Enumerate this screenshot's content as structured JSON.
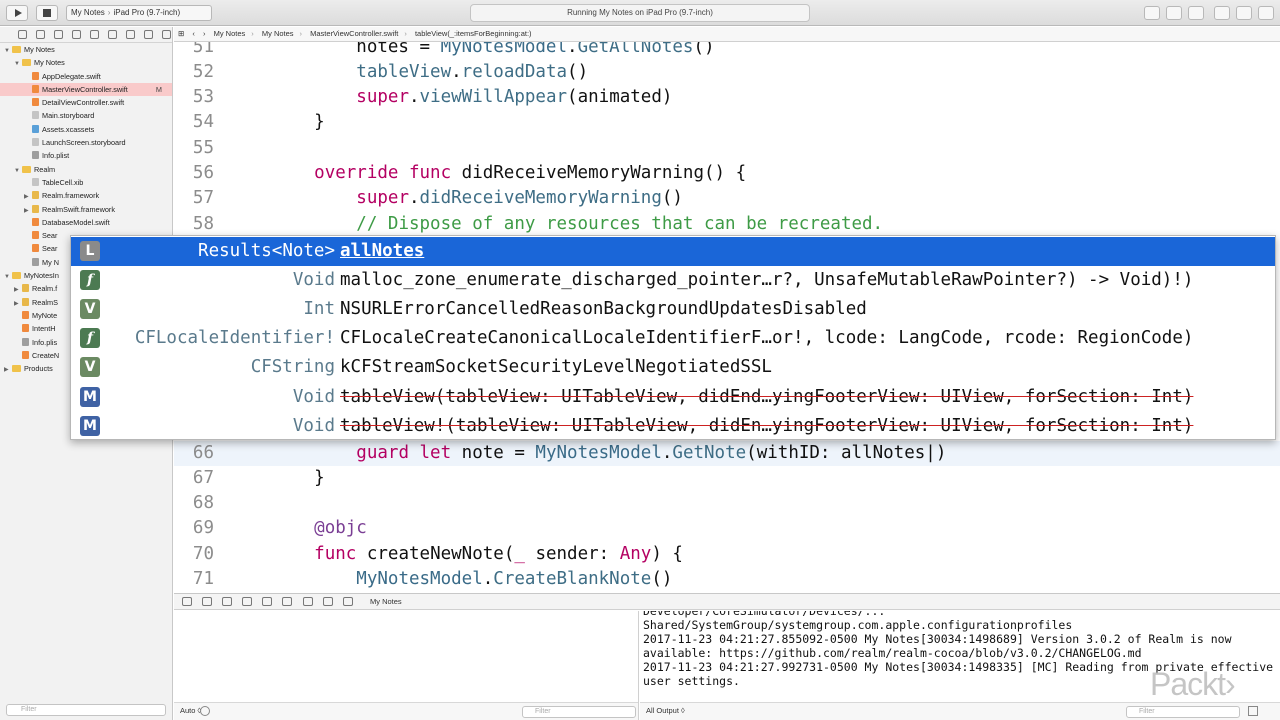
{
  "toolbar": {
    "scheme_app": "My Notes",
    "scheme_device": "iPad Pro (9.7-inch)",
    "activity": "Running My Notes on iPad Pro (9.7-inch)"
  },
  "navigator": {
    "filter_placeholder": "Filter",
    "items": [
      {
        "label": "My Notes",
        "indent": 0,
        "disc": "▼",
        "icon": "folder"
      },
      {
        "label": "My Notes",
        "indent": 1,
        "disc": "▼",
        "icon": "folder"
      },
      {
        "label": "AppDelegate.swift",
        "indent": 2,
        "disc": "",
        "icon": "swift"
      },
      {
        "label": "MasterViewController.swift",
        "indent": 2,
        "disc": "",
        "icon": "swift",
        "badge": "M",
        "selected": true
      },
      {
        "label": "DetailViewController.swift",
        "indent": 2,
        "disc": "",
        "icon": "swift"
      },
      {
        "label": "Main.storyboard",
        "indent": 2,
        "disc": "",
        "icon": "sb"
      },
      {
        "label": "Assets.xcassets",
        "indent": 2,
        "disc": "",
        "icon": "asset"
      },
      {
        "label": "LaunchScreen.storyboard",
        "indent": 2,
        "disc": "",
        "icon": "sb"
      },
      {
        "label": "Info.plist",
        "indent": 2,
        "disc": "",
        "icon": "plist"
      },
      {
        "label": "Realm",
        "indent": 1,
        "disc": "▼",
        "icon": "folder"
      },
      {
        "label": "TableCell.xib",
        "indent": 2,
        "disc": "",
        "icon": "sb"
      },
      {
        "label": "Realm.framework",
        "indent": 2,
        "disc": "▶",
        "icon": "fw"
      },
      {
        "label": "RealmSwift.framework",
        "indent": 2,
        "disc": "▶",
        "icon": "fw"
      },
      {
        "label": "DatabaseModel.swift",
        "indent": 2,
        "disc": "",
        "icon": "swift"
      },
      {
        "label": "Sear",
        "indent": 2,
        "disc": "",
        "icon": "swift"
      },
      {
        "label": "Sear",
        "indent": 2,
        "disc": "",
        "icon": "swift"
      },
      {
        "label": "My N",
        "indent": 2,
        "disc": "",
        "icon": "plist"
      },
      {
        "label": "MyNotesIn",
        "indent": 0,
        "disc": "▼",
        "icon": "folder"
      },
      {
        "label": "Realm.f",
        "indent": 1,
        "disc": "▶",
        "icon": "fw"
      },
      {
        "label": "RealmS",
        "indent": 1,
        "disc": "▶",
        "icon": "fw"
      },
      {
        "label": "MyNote",
        "indent": 1,
        "disc": "",
        "icon": "swift"
      },
      {
        "label": "IntentH",
        "indent": 1,
        "disc": "",
        "icon": "swift"
      },
      {
        "label": "Info.plis",
        "indent": 1,
        "disc": "",
        "icon": "plist"
      },
      {
        "label": "CreateN",
        "indent": 1,
        "disc": "",
        "icon": "swift"
      },
      {
        "label": "Products",
        "indent": 0,
        "disc": "▶",
        "icon": "folder"
      }
    ]
  },
  "jumpbar": {
    "project": "My Notes",
    "group": "My Notes",
    "file": "MasterViewController.swift",
    "symbol": "tableView(_:itemsForBeginning:at:)"
  },
  "editor": {
    "lines": [
      {
        "num": "51",
        "tokens": [
          [
            "plain",
            "        notes = "
          ],
          [
            "cls",
            "MyNotesModel"
          ],
          [
            "plain",
            "."
          ],
          [
            "fn",
            "GetAllNotes"
          ],
          [
            "plain",
            "()"
          ]
        ]
      },
      {
        "num": "52",
        "tokens": [
          [
            "plain",
            "        "
          ],
          [
            "fn",
            "tableView"
          ],
          [
            "plain",
            "."
          ],
          [
            "fn",
            "reloadData"
          ],
          [
            "plain",
            "()"
          ]
        ]
      },
      {
        "num": "53",
        "tokens": [
          [
            "plain",
            "        "
          ],
          [
            "kw",
            "super"
          ],
          [
            "plain",
            "."
          ],
          [
            "fn",
            "viewWillAppear"
          ],
          [
            "plain",
            "(animated)"
          ]
        ]
      },
      {
        "num": "54",
        "tokens": [
          [
            "plain",
            "    }"
          ]
        ]
      },
      {
        "num": "55",
        "tokens": []
      },
      {
        "num": "56",
        "tokens": [
          [
            "plain",
            "    "
          ],
          [
            "kw",
            "override func"
          ],
          [
            "plain",
            " didReceiveMemoryWarning() {"
          ]
        ]
      },
      {
        "num": "57",
        "tokens": [
          [
            "plain",
            "        "
          ],
          [
            "kw",
            "super"
          ],
          [
            "plain",
            "."
          ],
          [
            "fn",
            "didReceiveMemoryWarning"
          ],
          [
            "plain",
            "()"
          ]
        ]
      },
      {
        "num": "58",
        "tokens": [
          [
            "plain",
            "        "
          ],
          [
            "cm",
            "// Dispose of any resources that can be recreated."
          ]
        ]
      },
      {
        "num": "59",
        "tokens": []
      },
      {
        "num": "60",
        "tokens": []
      },
      {
        "num": "61",
        "tokens": []
      },
      {
        "num": "62",
        "tokens": []
      },
      {
        "num": "63",
        "tokens": []
      },
      {
        "num": "64",
        "tokens": []
      },
      {
        "num": "65",
        "tokens": []
      },
      {
        "num": "66",
        "tokens": [
          [
            "plain",
            "        "
          ],
          [
            "kw",
            "guard let"
          ],
          [
            "plain",
            " note = "
          ],
          [
            "cls",
            "MyNotesModel"
          ],
          [
            "plain",
            "."
          ],
          [
            "fn",
            "GetNote"
          ],
          [
            "plain",
            "(withID: allNotes|)"
          ]
        ],
        "current": true
      },
      {
        "num": "67",
        "tokens": [
          [
            "plain",
            "    }"
          ]
        ]
      },
      {
        "num": "68",
        "tokens": []
      },
      {
        "num": "69",
        "tokens": [
          [
            "plain",
            "    "
          ],
          [
            "att",
            "@objc"
          ]
        ]
      },
      {
        "num": "70",
        "tokens": [
          [
            "plain",
            "    "
          ],
          [
            "kw",
            "func"
          ],
          [
            "plain",
            " createNewNote("
          ],
          [
            "kw",
            "_"
          ],
          [
            "plain",
            " sender: "
          ],
          [
            "kw",
            "Any"
          ],
          [
            "plain",
            ") {"
          ]
        ]
      },
      {
        "num": "71",
        "tokens": [
          [
            "plain",
            "        "
          ],
          [
            "cls",
            "MyNotesModel"
          ],
          [
            "plain",
            "."
          ],
          [
            "fn",
            "CreateBlankNote"
          ],
          [
            "plain",
            "()"
          ]
        ]
      }
    ]
  },
  "completion": {
    "items": [
      {
        "kind": "L",
        "type": "Results<Note>",
        "name": "allNotes",
        "selected": true
      },
      {
        "kind": "f",
        "type": "Void",
        "name": "malloc_zone_enumerate_discharged_pointer…r?, UnsafeMutableRawPointer?) -> Void)!)"
      },
      {
        "kind": "V",
        "type": "Int",
        "name": "NSURLErrorCancelledReasonBackgroundUpdatesDisabled"
      },
      {
        "kind": "f",
        "type": "CFLocaleIdentifier!",
        "name": "CFLocaleCreateCanonicalLocaleIdentifierF…or!, lcode: LangCode, rcode: RegionCode)"
      },
      {
        "kind": "V",
        "type": "CFString",
        "name": "kCFStreamSocketSecurityLevelNegotiatedSSL"
      },
      {
        "kind": "M",
        "type": "Void",
        "name": "tableView(tableView: UITableView, didEnd…yingFooterView: UIView, forSection: Int)",
        "deprecated": true
      },
      {
        "kind": "M",
        "type": "Void",
        "name": "tableView!(tableView: UITableView, didEn…yingFooterView: UIView, forSection: Int)",
        "deprecated": true
      }
    ]
  },
  "debug": {
    "title": "My Notes",
    "variables_mode": "Auto ◊",
    "filter_placeholder": "Filter",
    "output_mode": "All Output ◊",
    "console_text": "Developer/CoreSimulator/Devices/...\nShared/SystemGroup/systemgroup.com.apple.configurationprofiles\n2017-11-23 04:21:27.855092-0500 My Notes[30034:1498689] Version 3.0.2 of Realm is now available: https://github.com/realm/realm-cocoa/blob/v3.0.2/CHANGELOG.md\n2017-11-23 04:21:27.992731-0500 My Notes[30034:1498335] [MC] Reading from private effective user settings."
  },
  "watermark": "Packt›"
}
